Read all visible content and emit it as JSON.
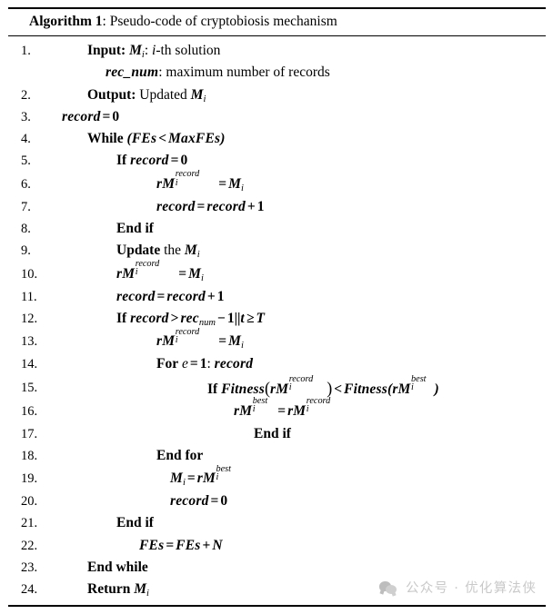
{
  "document": {
    "caption_label": "Algorithm 1",
    "caption_sep": ":",
    "caption_title": " Pseudo-code of cryptobiosis mechanism"
  },
  "lines": [
    {
      "n": "1.",
      "text": "Input: M_i: i-th solution"
    },
    {
      "n": "",
      "text": "rec_num: maximum number of records"
    },
    {
      "n": "2.",
      "text": "Output: Updated M_i"
    },
    {
      "n": "3.",
      "text": "record = 0"
    },
    {
      "n": "4.",
      "text": "While (FEs < MaxFEs)"
    },
    {
      "n": "5.",
      "text": "If record = 0"
    },
    {
      "n": "6.",
      "text": "rM_i^record = M_i"
    },
    {
      "n": "7.",
      "text": "record = record + 1"
    },
    {
      "n": "8.",
      "text": "End if"
    },
    {
      "n": "9.",
      "text": "Update the M_i"
    },
    {
      "n": "10.",
      "text": "rM_i^record = M_i"
    },
    {
      "n": "11.",
      "text": "record = record + 1"
    },
    {
      "n": "12.",
      "text": "If record > rec_num - 1||t >= T"
    },
    {
      "n": "13.",
      "text": "rM_i^record = M_i"
    },
    {
      "n": "14.",
      "text": "For e = 1: record"
    },
    {
      "n": "15.",
      "text": "If Fitness(rM_i^record) < Fitness(rM_i^best)"
    },
    {
      "n": "16.",
      "text": "rM_i^best = rM_i^record"
    },
    {
      "n": "17.",
      "text": "End if"
    },
    {
      "n": "18.",
      "text": "End for"
    },
    {
      "n": "19.",
      "text": "M_i = rM_i^best"
    },
    {
      "n": "20.",
      "text": "record = 0"
    },
    {
      "n": "21.",
      "text": "End if"
    },
    {
      "n": "22.",
      "text": "FEs = FEs + N"
    },
    {
      "n": "23.",
      "text": "End while"
    },
    {
      "n": "24.",
      "text": "Return M_i"
    }
  ],
  "line_numbers": {
    "n1": "1.",
    "n2": "2.",
    "n3": "3.",
    "n4": "4.",
    "n5": "5.",
    "n6": "6.",
    "n7": "7.",
    "n8": "8.",
    "n9": "9.",
    "n10": "10.",
    "n11": "11.",
    "n12": "12.",
    "n13": "13.",
    "n14": "14.",
    "n15": "15.",
    "n16": "16.",
    "n17": "17.",
    "n18": "18.",
    "n19": "19.",
    "n20": "20.",
    "n21": "21.",
    "n22": "22.",
    "n23": "23.",
    "n24": "24.",
    "blank": ""
  },
  "tokens": {
    "input_kw": "Input:",
    "output_kw": "Output:",
    "updated": "Updated",
    "ith_solution": "-th solution",
    "rec_num_var": "rec_num",
    "rec_num_desc": ": maximum number of records",
    "while_kw": "While",
    "if_kw": "If",
    "end_if_kw": "End if",
    "end_for_kw": "End for",
    "end_while_kw": "End while",
    "update_kw": "Update",
    "the_word": "the",
    "for_kw": "For",
    "return_kw": "Return",
    "record_var": "record",
    "fes_var": "FEs",
    "maxfes_var": "MaxFEs",
    "fitness_var": "Fitness",
    "M": "M",
    "rM": "rM",
    "N": "N",
    "T": "T",
    "t": "t",
    "e": "e",
    "i_sub": "i",
    "record_sup": "record",
    "best_sup": "best",
    "num_sub": "num",
    "zero": "0",
    "one": "1",
    "eq": "=",
    "lt": "<",
    "gt": ">",
    "ge": "≥",
    "plus": "+",
    "minus": "−",
    "colon": ":",
    "or_or": "||",
    "lparen": "(",
    "rparen": ")"
  },
  "watermark": {
    "icon": "wechat-bubbles-icon",
    "text": "公众号 · 优化算法侠"
  },
  "colors": {
    "text": "#000000",
    "background": "#ffffff",
    "rule": "#000000",
    "watermark": "#c9c9c9"
  }
}
